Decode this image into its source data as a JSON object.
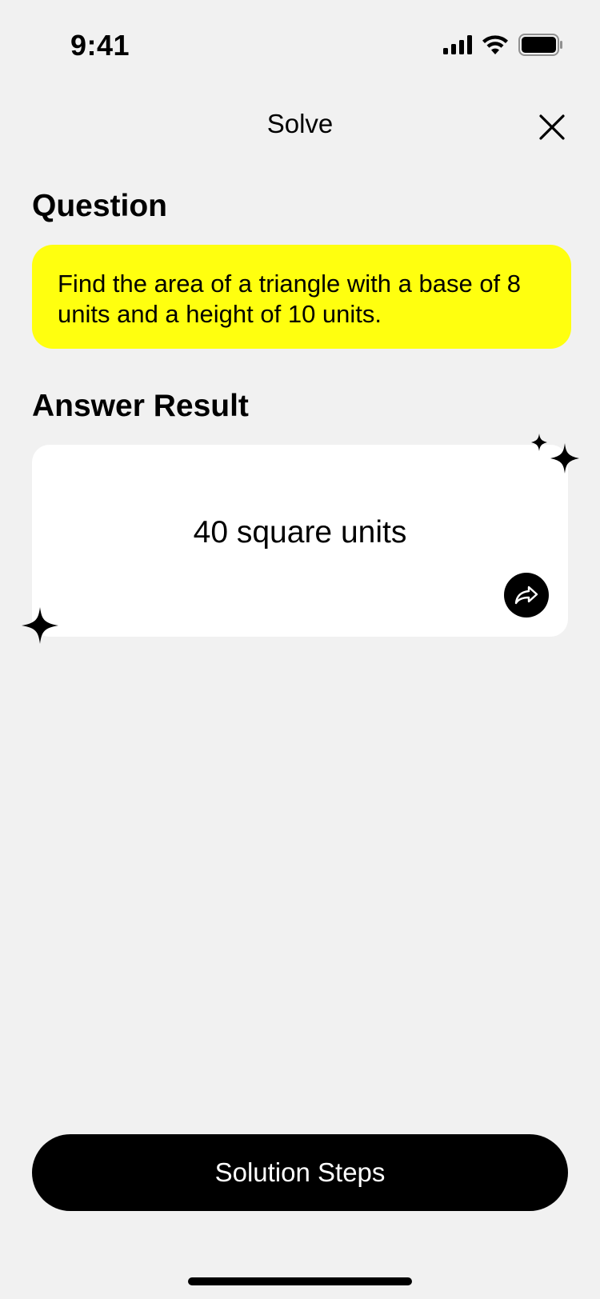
{
  "status_bar": {
    "time": "9:41",
    "icons": [
      "signal-icon",
      "wifi-icon",
      "battery-icon"
    ]
  },
  "header": {
    "title": "Solve",
    "close_icon": "close-icon"
  },
  "question": {
    "heading": "Question",
    "text": "Find the area of a triangle with a base of 8 units and a height of 10 units.",
    "card_color": "#ffff0f"
  },
  "answer": {
    "heading": "Answer Result",
    "value": "40 square units",
    "share_icon": "share-icon",
    "decoration_icon": "sparkle-icon"
  },
  "footer": {
    "button_label": "Solution Steps"
  },
  "colors": {
    "background": "#f1f1f1",
    "accent": "#ffff0f",
    "primary": "#000000",
    "card": "#ffffff"
  }
}
